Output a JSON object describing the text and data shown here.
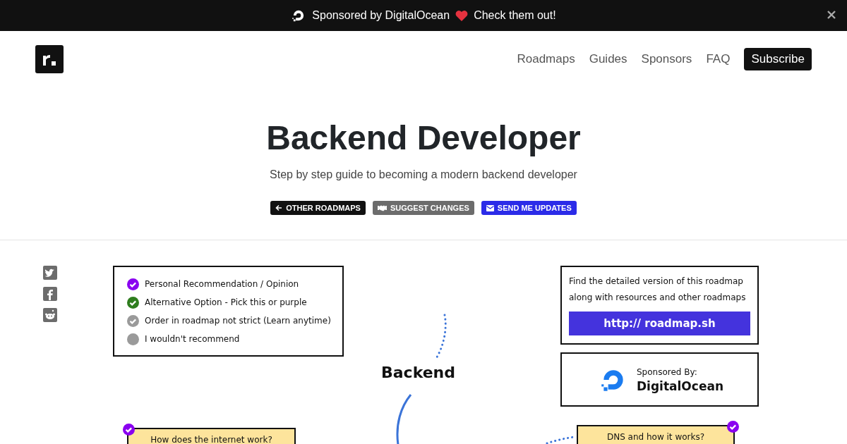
{
  "sponsor_bar": {
    "lead": "Sponsored by DigitalOcean",
    "cta": "Check them out!"
  },
  "nav": {
    "links": [
      "Roadmaps",
      "Guides",
      "Sponsors",
      "FAQ"
    ],
    "subscribe": "Subscribe"
  },
  "hero": {
    "title": "Backend Developer",
    "subtitle": "Step by step guide to becoming a modern backend developer",
    "buttons": [
      {
        "kind": "back",
        "label": "OTHER ROADMAPS"
      },
      {
        "kind": "suggest",
        "label": "SUGGEST CHANGES"
      },
      {
        "kind": "updates",
        "label": "SEND ME UPDATES"
      }
    ]
  },
  "share": [
    {
      "kind": "twitter"
    },
    {
      "kind": "facebook"
    },
    {
      "kind": "reddit"
    }
  ],
  "roadmap": {
    "legend": [
      {
        "label": "Personal Recommendation / Opinion",
        "color": "#8a00f0",
        "checked": true
      },
      {
        "label": "Alternative Option - Pick this or purple",
        "color": "#2e7d1e",
        "checked": true
      },
      {
        "label": "Order in roadmap not strict (Learn anytime)",
        "color": "#9a9a9a",
        "checked": true
      },
      {
        "label": "I wouldn't recommend",
        "color": "#9a9a9a",
        "checked": false
      }
    ],
    "info": {
      "lines": [
        "Find the detailed version of this roadmap",
        "along with resources and other roadmaps"
      ],
      "link": "http:// roadmap.sh"
    },
    "sponsor": {
      "caption": "Sponsored By:",
      "name": "DigitalOcean"
    },
    "center": "Backend",
    "nodes": [
      {
        "label": "How does the internet work?",
        "color": "#8a00f0",
        "kind": "left"
      },
      {
        "label": "DNS and how it works?",
        "color": "#8a00f0",
        "kind": "right"
      }
    ]
  }
}
